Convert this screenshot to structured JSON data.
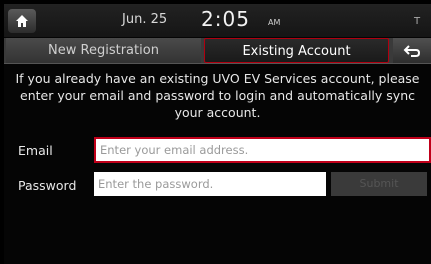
{
  "status_bar": {
    "date": "Jun. 25",
    "time": "2:05",
    "ampm": "AM",
    "home_icon": "home-icon",
    "status_icon_text": "T"
  },
  "tabs": [
    {
      "label": "New Registration",
      "active": false
    },
    {
      "label": "Existing Account",
      "active": true
    }
  ],
  "back_icon": "back-arrow-icon",
  "message": "If you already have an existing UVO EV Services account, please enter your email and password to login and automatically sync your account.",
  "form": {
    "email_label": "Email",
    "email_placeholder": "Enter your email address.",
    "password_label": "Password",
    "password_placeholder": "Enter the password.",
    "submit_label": "Submit"
  },
  "colors": {
    "accent": "#c0001a",
    "background": "#050505"
  }
}
